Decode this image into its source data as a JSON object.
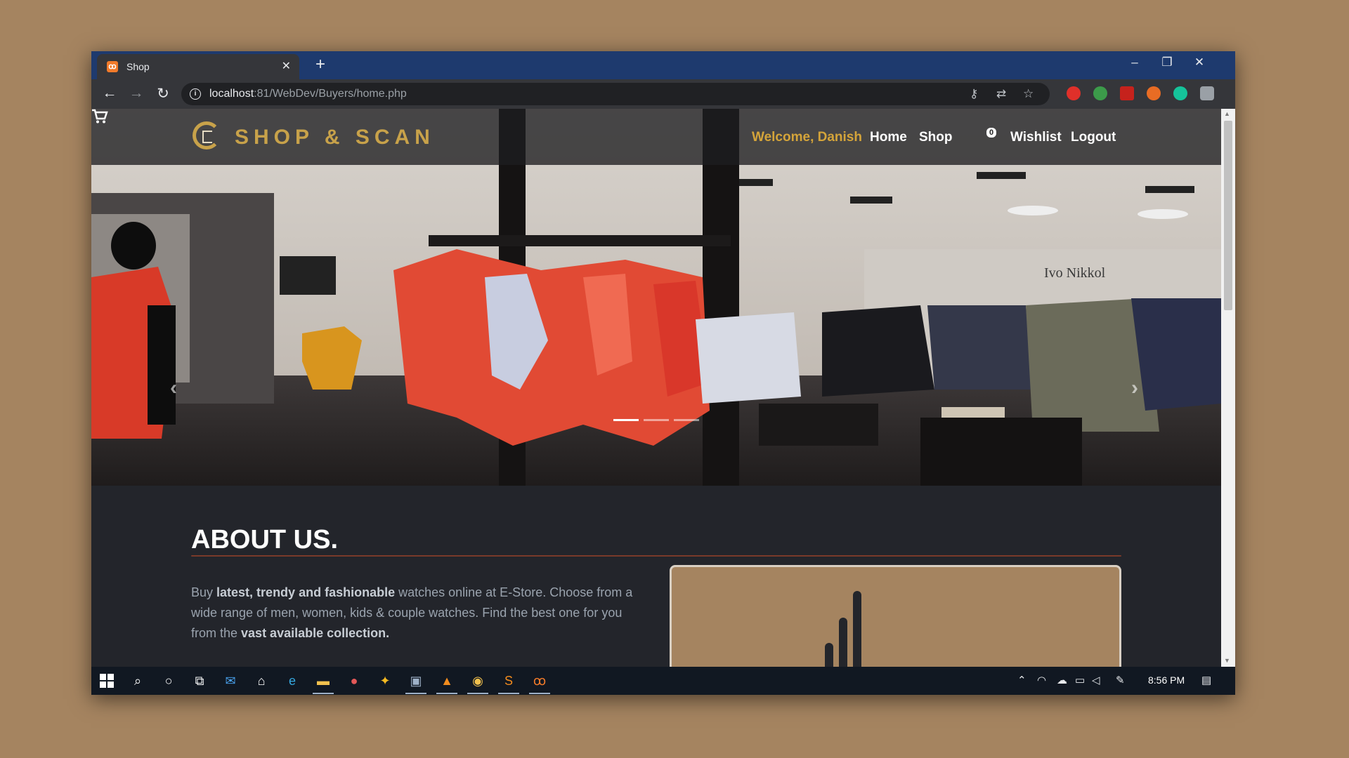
{
  "browser": {
    "tab_title": "Shop",
    "tab_favicon": "xampp-icon",
    "new_tab_label": "+",
    "url_host": "localhost",
    "url_rest": ":81/WebDev/Buyers/home.php",
    "window_controls": [
      "–",
      "❐",
      "✕"
    ]
  },
  "site": {
    "brand": "SHOP & SCAN",
    "nav": {
      "welcome": "Welcome, Danish",
      "home": "Home",
      "shop": "Shop",
      "cart_count": "0",
      "wishlist": "Wishlist",
      "logout": "Logout"
    },
    "hero": {
      "store_sign": "Ivo Nikkol",
      "slides": 3,
      "active_slide": 1
    },
    "about": {
      "title": "ABOUT US.",
      "text_1": "Buy ",
      "bold_1": "latest, trendy and fashionable",
      "text_2": " watches online at E-Store. Choose from a wide range of men, women, kids & couple watches. Find the best one for you from the ",
      "bold_2": "vast available collection."
    }
  },
  "taskbar": {
    "time": "8:56 PM"
  },
  "colors": {
    "accent_gold": "#c8a24a",
    "welcome": "#d4a43a",
    "page_bg": "#23252b",
    "desktop_bg": "#a58460",
    "titlebar": "#1e3a6e"
  }
}
